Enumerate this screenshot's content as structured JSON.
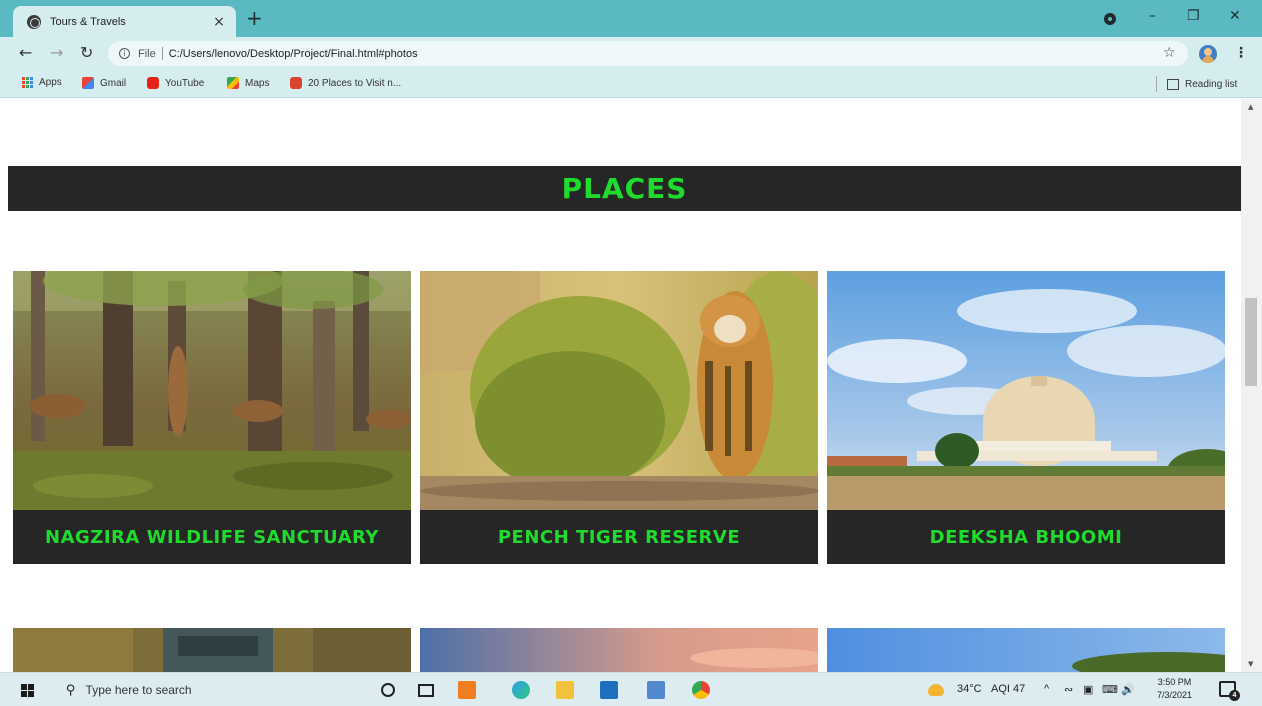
{
  "browser": {
    "tab_title": "Tours & Travels",
    "tab_close": "×",
    "new_tab": "+",
    "omnibox": {
      "scheme": "File",
      "url": "C:/Users/lenovo/Desktop/Project/Final.html#photos"
    },
    "bookmarks": [
      "Apps",
      "Gmail",
      "YouTube",
      "Maps",
      "20 Places to Visit n..."
    ],
    "reading_list": "Reading list"
  },
  "page": {
    "section_title": "PLACES",
    "cards": [
      {
        "title": "NAGZIRA WILDLIFE SANCTUARY"
      },
      {
        "title": "PENCH TIGER RESERVE"
      },
      {
        "title": "DEEKSHA BHOOMI"
      }
    ]
  },
  "taskbar": {
    "search_placeholder": "Type here to search",
    "weather": "34°C",
    "aqi": "AQI 47",
    "time": "3:50 PM",
    "date": "7/3/2021",
    "notifications": "4"
  },
  "colors": {
    "accent_green": "#1fdc2c",
    "banner_dark": "#262626",
    "chrome_teal": "#5bbac1"
  }
}
